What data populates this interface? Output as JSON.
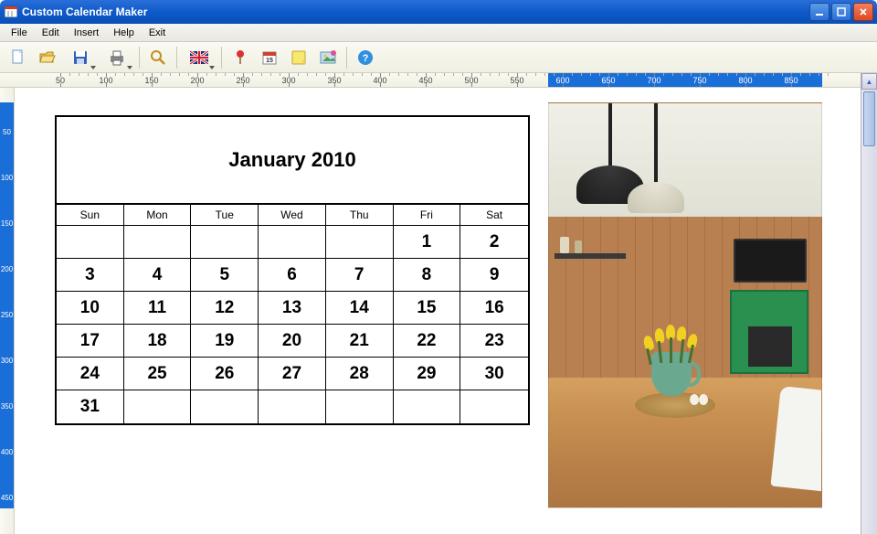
{
  "window": {
    "title": "Custom Calendar Maker"
  },
  "menu": {
    "file": "File",
    "edit": "Edit",
    "insert": "Insert",
    "help": "Help",
    "exit": "Exit"
  },
  "ruler_h": {
    "marks": [
      50,
      100,
      150,
      200,
      250,
      300,
      350,
      400,
      450,
      500,
      550,
      600,
      650,
      700,
      750,
      800,
      850
    ],
    "sel_start": 584,
    "sel_end": 884
  },
  "ruler_v": {
    "marks": [
      50,
      100,
      150,
      200,
      250,
      300,
      350,
      400,
      450
    ],
    "sel_start": 16,
    "sel_end": 460
  },
  "calendar": {
    "title": "January 2010",
    "days": [
      "Sun",
      "Mon",
      "Tue",
      "Wed",
      "Thu",
      "Fri",
      "Sat"
    ],
    "weeks": [
      [
        "",
        "",
        "",
        "",
        "",
        "1",
        "2"
      ],
      [
        "3",
        "4",
        "5",
        "6",
        "7",
        "8",
        "9"
      ],
      [
        "10",
        "11",
        "12",
        "13",
        "14",
        "15",
        "16"
      ],
      [
        "17",
        "18",
        "19",
        "20",
        "21",
        "22",
        "23"
      ],
      [
        "24",
        "25",
        "26",
        "27",
        "28",
        "29",
        "30"
      ],
      [
        "31",
        "",
        "",
        "",
        "",
        "",
        ""
      ]
    ]
  },
  "toolbar": {
    "icons": [
      "new",
      "open",
      "save",
      "print",
      "zoom",
      "language",
      "pin",
      "calendar",
      "note",
      "image",
      "help"
    ]
  }
}
